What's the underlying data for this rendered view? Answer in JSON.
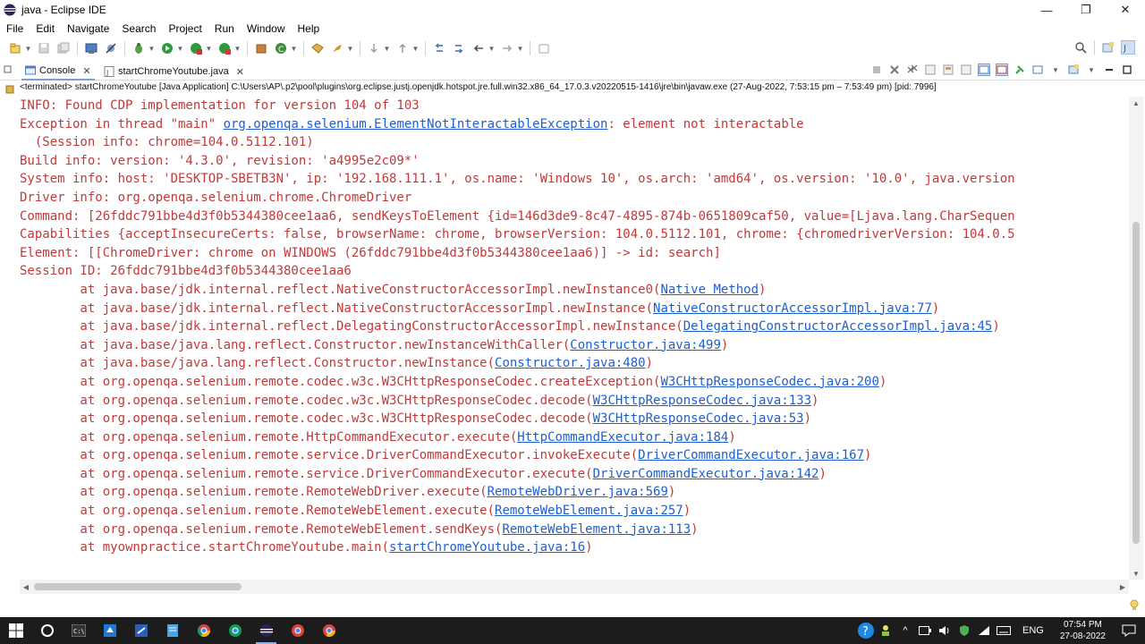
{
  "window": {
    "title": "java - Eclipse IDE",
    "controls": {
      "minimize": "—",
      "restore": "❐",
      "close": "✕"
    }
  },
  "menubar": {
    "items": [
      "File",
      "Edit",
      "Navigate",
      "Search",
      "Project",
      "Run",
      "Window",
      "Help"
    ]
  },
  "tabs": [
    {
      "label": "Console",
      "icon": "console-icon",
      "close": "✕"
    },
    {
      "label": "startChromeYoutube.java",
      "icon": "java-file-icon",
      "close": "✕"
    }
  ],
  "console": {
    "terminated_line": "<terminated> startChromeYoutube [Java Application] C:\\Users\\AP\\.p2\\pool\\plugins\\org.eclipse.justj.openjdk.hotspot.jre.full.win32.x86_64_17.0.3.v20220515-1416\\jre\\bin\\javaw.exe  (27-Aug-2022, 7:53:15 pm – 7:53:49 pm) [pid: 7996]",
    "lines": [
      {
        "text": "INFO: Found CDP implementation for version 104 of 103",
        "link": "",
        "after": ""
      },
      {
        "text": "Exception in thread \"main\" ",
        "link": "org.openqa.selenium.ElementNotInteractableException",
        "after": ": element not interactable"
      },
      {
        "text": "  (Session info: chrome=104.0.5112.101)",
        "link": "",
        "after": ""
      },
      {
        "text": "Build info: version: '4.3.0', revision: 'a4995e2c09*'",
        "link": "",
        "after": ""
      },
      {
        "text": "System info: host: 'DESKTOP-SBETB3N', ip: '192.168.111.1', os.name: 'Windows 10', os.arch: 'amd64', os.version: '10.0', java.version",
        "link": "",
        "after": ""
      },
      {
        "text": "Driver info: org.openqa.selenium.chrome.ChromeDriver",
        "link": "",
        "after": ""
      },
      {
        "text": "Command: [26fddc791bbe4d3f0b5344380cee1aa6, sendKeysToElement {id=146d3de9-8c47-4895-874b-0651809caf50, value=[Ljava.lang.CharSequen",
        "link": "",
        "after": ""
      },
      {
        "text": "Capabilities {acceptInsecureCerts: false, browserName: chrome, browserVersion: 104.0.5112.101, chrome: {chromedriverVersion: 104.0.5",
        "link": "",
        "after": ""
      },
      {
        "text": "Element: [[ChromeDriver: chrome on WINDOWS (26fddc791bbe4d3f0b5344380cee1aa6)] -> id: search]",
        "link": "",
        "after": ""
      },
      {
        "text": "Session ID: 26fddc791bbe4d3f0b5344380cee1aa6",
        "link": "",
        "after": ""
      },
      {
        "text": "\tat java.base/jdk.internal.reflect.NativeConstructorAccessorImpl.newInstance0(",
        "link": "Native Method",
        "after": ")"
      },
      {
        "text": "\tat java.base/jdk.internal.reflect.NativeConstructorAccessorImpl.newInstance(",
        "link": "NativeConstructorAccessorImpl.java:77",
        "after": ")"
      },
      {
        "text": "\tat java.base/jdk.internal.reflect.DelegatingConstructorAccessorImpl.newInstance(",
        "link": "DelegatingConstructorAccessorImpl.java:45",
        "after": ")"
      },
      {
        "text": "\tat java.base/java.lang.reflect.Constructor.newInstanceWithCaller(",
        "link": "Constructor.java:499",
        "after": ")"
      },
      {
        "text": "\tat java.base/java.lang.reflect.Constructor.newInstance(",
        "link": "Constructor.java:480",
        "after": ")"
      },
      {
        "text": "\tat org.openqa.selenium.remote.codec.w3c.W3CHttpResponseCodec.createException(",
        "link": "W3CHttpResponseCodec.java:200",
        "after": ")"
      },
      {
        "text": "\tat org.openqa.selenium.remote.codec.w3c.W3CHttpResponseCodec.decode(",
        "link": "W3CHttpResponseCodec.java:133",
        "after": ")"
      },
      {
        "text": "\tat org.openqa.selenium.remote.codec.w3c.W3CHttpResponseCodec.decode(",
        "link": "W3CHttpResponseCodec.java:53",
        "after": ")"
      },
      {
        "text": "\tat org.openqa.selenium.remote.HttpCommandExecutor.execute(",
        "link": "HttpCommandExecutor.java:184",
        "after": ")"
      },
      {
        "text": "\tat org.openqa.selenium.remote.service.DriverCommandExecutor.invokeExecute(",
        "link": "DriverCommandExecutor.java:167",
        "after": ")"
      },
      {
        "text": "\tat org.openqa.selenium.remote.service.DriverCommandExecutor.execute(",
        "link": "DriverCommandExecutor.java:142",
        "after": ")"
      },
      {
        "text": "\tat org.openqa.selenium.remote.RemoteWebDriver.execute(",
        "link": "RemoteWebDriver.java:569",
        "after": ")"
      },
      {
        "text": "\tat org.openqa.selenium.remote.RemoteWebElement.execute(",
        "link": "RemoteWebElement.java:257",
        "after": ")"
      },
      {
        "text": "\tat org.openqa.selenium.remote.RemoteWebElement.sendKeys(",
        "link": "RemoteWebElement.java:113",
        "after": ")"
      },
      {
        "text": "\tat myownpractice.startChromeYoutube.main(",
        "link": "startChromeYoutube.java:16",
        "after": ")"
      }
    ]
  },
  "taskbar": {
    "language": "ENG",
    "time": "07:54 PM",
    "date": "27-08-2022"
  },
  "colors": {
    "error_text": "#c03a3a",
    "link": "#1e5fd0",
    "taskbar": "#1c1c1c"
  }
}
